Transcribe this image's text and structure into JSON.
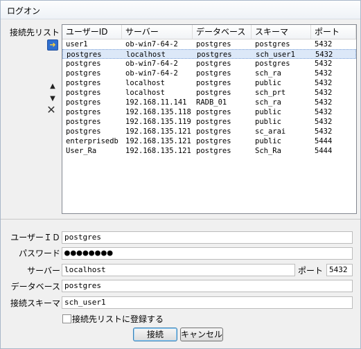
{
  "window": {
    "title": "ログオン"
  },
  "connection_list": {
    "label": "接続先リスト",
    "icons": [
      "login-icon",
      "up-icon",
      "down-icon",
      "delete-icon"
    ],
    "columns": [
      "ユーザーID",
      "サーバー",
      "データベース",
      "スキーマ",
      "ポート"
    ],
    "rows": [
      [
        "user1",
        "ob-win7-64-2",
        "postgres",
        "postgres",
        "5432"
      ],
      [
        "postgres",
        "localhost",
        "postgres",
        "sch_user1",
        "5432"
      ],
      [
        "postgres",
        "ob-win7-64-2",
        "postgres",
        "postgres",
        "5432"
      ],
      [
        "postgres",
        "ob-win7-64-2",
        "postgres",
        "sch_ra",
        "5432"
      ],
      [
        "postgres",
        "localhost",
        "postgres",
        "public",
        "5432"
      ],
      [
        "postgres",
        "localhost",
        "postgres",
        "sch_prt",
        "5432"
      ],
      [
        "postgres",
        "192.168.11.141",
        "RADB_01",
        "sch_ra",
        "5432"
      ],
      [
        "postgres",
        "192.168.135.118",
        "postgres",
        "public",
        "5432"
      ],
      [
        "postgres",
        "192.168.135.119",
        "postgres",
        "public",
        "5432"
      ],
      [
        "postgres",
        "192.168.135.121",
        "postgres",
        "sc_arai",
        "5432"
      ],
      [
        "enterprisedb",
        "192.168.135.121",
        "postgres",
        "public",
        "5444"
      ],
      [
        "User_Ra",
        "192.168.135.121",
        "postgres",
        "Sch_Ra",
        "5444"
      ]
    ],
    "selected_row": 1
  },
  "form": {
    "user_id_label": "ユーザーＩＤ",
    "user_id_value": "postgres",
    "password_label": "パスワード",
    "password_value": "●●●●●●●●",
    "server_label": "サーバー",
    "server_value": "localhost",
    "port_label": "ポート",
    "port_value": "5432",
    "database_label": "データベース",
    "database_value": "postgres",
    "schema_label": "接続スキーマ",
    "schema_value": "sch_user1",
    "register_label": "接続先リストに登録する",
    "register_checked": false
  },
  "buttons": {
    "connect": "接続",
    "cancel": "キャンセル"
  }
}
